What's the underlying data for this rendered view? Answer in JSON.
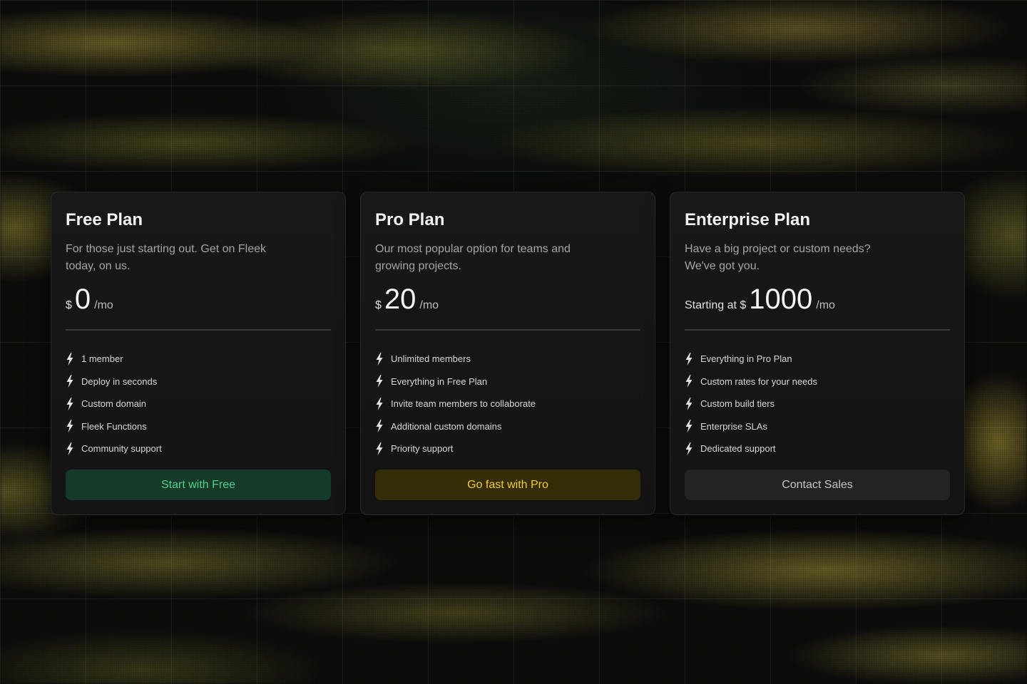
{
  "plans": [
    {
      "title": "Free Plan",
      "description": "For those just starting out. Get on Fleek today, on us.",
      "price_prefix": "$",
      "price": "0",
      "period": "/mo",
      "features": [
        "1 member",
        "Deploy in seconds",
        "Custom domain",
        "Fleek Functions",
        "Community support"
      ],
      "cta_label": "Start with Free",
      "accent": "#4fd18d"
    },
    {
      "title": "Pro Plan",
      "description": "Our most popular option for teams and growing projects.",
      "price_prefix": "$",
      "price": "20",
      "period": "/mo",
      "features": [
        "Unlimited members",
        "Everything in Free Plan",
        "Invite team members to collaborate",
        "Additional custom domains",
        "Priority support"
      ],
      "cta_label": "Go fast with Pro",
      "accent": "#f3cd2c"
    },
    {
      "title": "Enterprise Plan",
      "description": "Have a big project or custom needs? We've got you.",
      "price_prefix": "Starting at $",
      "price": "1000",
      "period": "/mo",
      "features": [
        "Everything in Pro Plan",
        "Custom rates for your needs",
        "Custom build tiers",
        "Enterprise SLAs",
        "Dedicated support"
      ],
      "cta_label": "Contact Sales",
      "accent": "#c4c4c4"
    }
  ],
  "feature_icon": "lightning-bolt-icon"
}
